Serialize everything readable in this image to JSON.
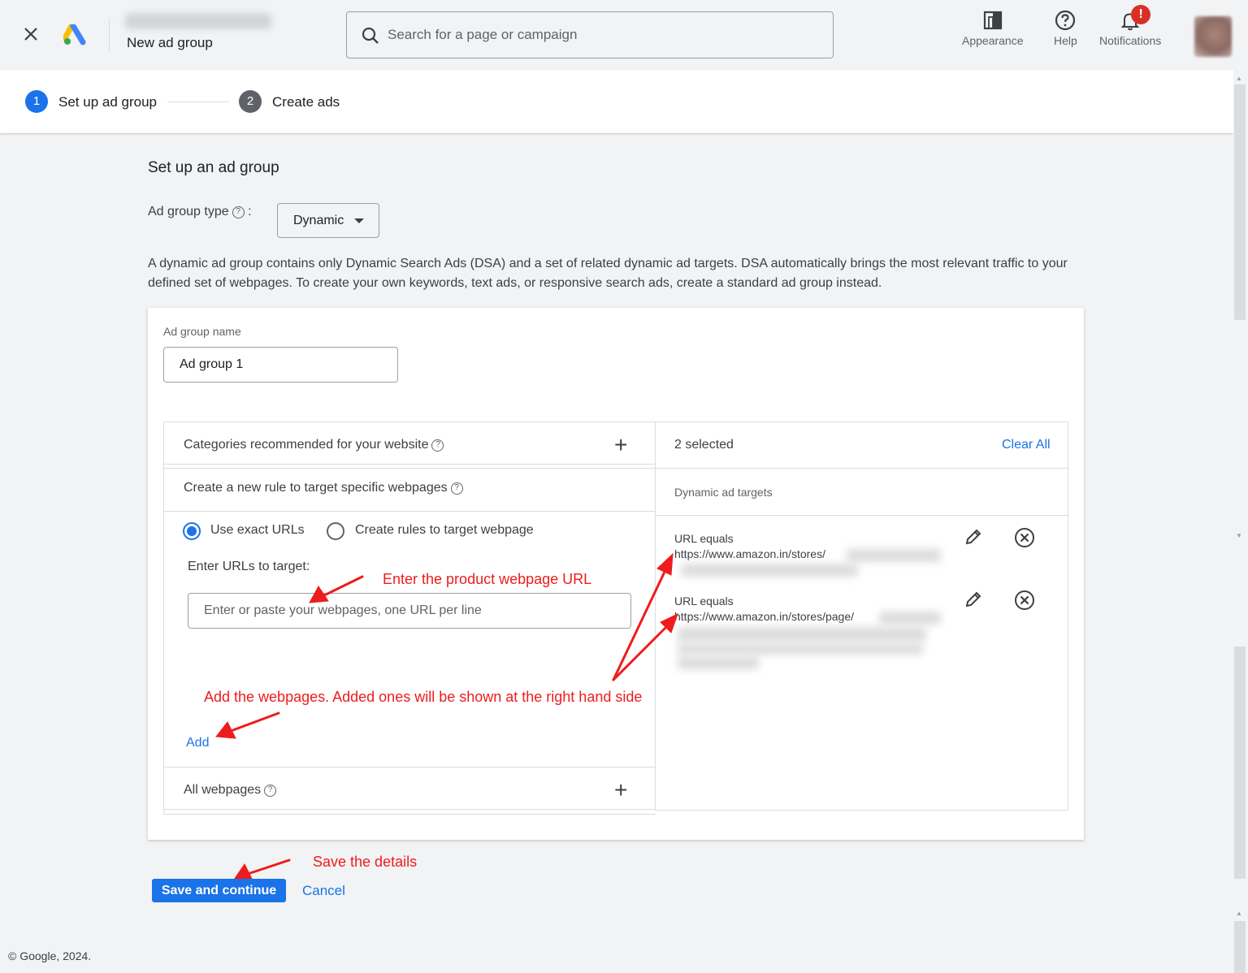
{
  "topbar": {
    "title": "New ad group",
    "search_placeholder": "Search for a page or campaign",
    "actions": [
      {
        "label": "Appearance",
        "icon": "appearance-icon"
      },
      {
        "label": "Help",
        "icon": "help-icon"
      },
      {
        "label": "Notifications",
        "icon": "bell-icon",
        "badge": "!"
      }
    ]
  },
  "stepper": {
    "steps": [
      {
        "number": "1",
        "label": "Set up ad group",
        "state": "active",
        "color": "#1a73e8"
      },
      {
        "number": "2",
        "label": "Create ads",
        "state": "upcoming",
        "color": "#5f6368"
      }
    ]
  },
  "main": {
    "section_title": "Set up an ad group",
    "ad_group_type_label": "Ad group type",
    "help_glyph": "?",
    "type_colon": ":",
    "ad_group_type_value": "Dynamic",
    "description": "A dynamic ad group contains only Dynamic Search Ads (DSA) and a set of related dynamic ad targets. DSA automatically brings the most relevant traffic to your defined set of webpages. To create your own keywords, text ads, or responsive search ads, create a standard ad group instead.",
    "card": {
      "ad_group_name_label": "Ad group name",
      "ad_group_name_value": "Ad group 1",
      "left": {
        "categories_title": "Categories recommended for your website",
        "rule_title": "Create a new rule to target specific webpages",
        "radio_exact": "Use exact URLs",
        "radio_rules": "Create rules to target webpage",
        "urls_label": "Enter URLs to target:",
        "urls_placeholder": "Enter or paste your webpages, one URL per line",
        "add_label": "Add",
        "all_webpages_title": "All webpages"
      },
      "right": {
        "selected_count": "2 selected",
        "clear_all": "Clear All",
        "targets_label": "Dynamic ad targets",
        "targets": [
          {
            "type": "URL equals",
            "url": "https://www.amazon.in/stores/"
          },
          {
            "type": "URL equals",
            "url": "https://www.amazon.in/stores/page/"
          }
        ]
      }
    },
    "save_button": "Save and continue",
    "cancel_button": "Cancel"
  },
  "annotations": {
    "url_hint": "Enter the product webpage URL",
    "add_hint": "Add the webpages. Added ones will be shown at the right hand side",
    "save_hint": "Save the details",
    "color": "#ee1c1c"
  },
  "footer": {
    "copyright": "© Google, 2024."
  },
  "colors": {
    "accent": "#1a73e8",
    "background": "#f1f3f4",
    "badge": "#d93025"
  }
}
